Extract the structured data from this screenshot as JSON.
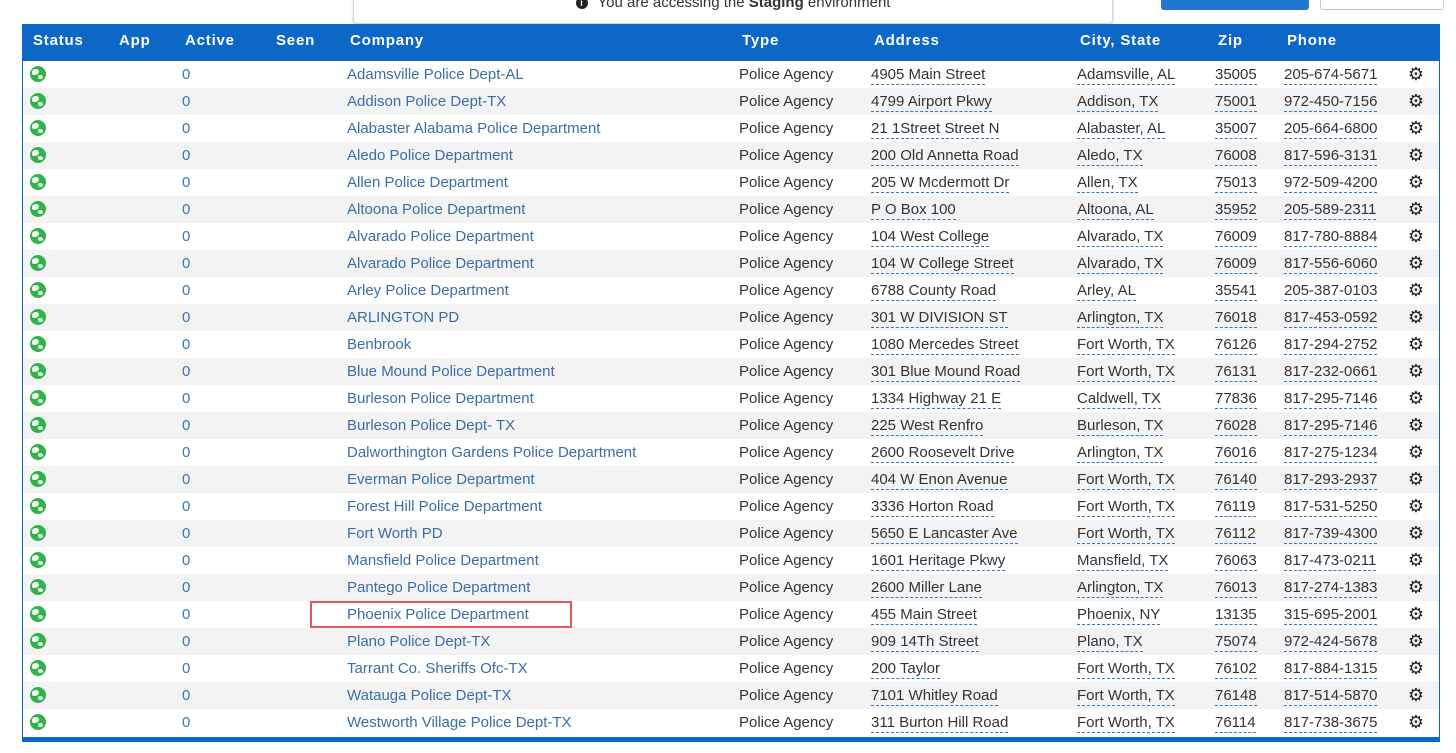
{
  "banner": {
    "prefix": "You are accessing the ",
    "env": "Staging",
    "suffix": " environment"
  },
  "table": {
    "headers": {
      "status": "Status",
      "app": "App",
      "active": "Active",
      "seen": "Seen",
      "company": "Company",
      "type": "Type",
      "address": "Address",
      "city_state": "City, State",
      "zip": "Zip",
      "phone": "Phone"
    },
    "rows": [
      {
        "active": "0",
        "company": "Adamsville Police Dept-AL",
        "type": "Police Agency",
        "address": "4905 Main Street",
        "city": "Adamsville, AL",
        "zip": "35005",
        "phone": "205-674-5671"
      },
      {
        "active": "0",
        "company": "Addison Police Dept-TX",
        "type": "Police Agency",
        "address": "4799 Airport Pkwy",
        "city": "Addison, TX",
        "zip": "75001",
        "phone": "972-450-7156"
      },
      {
        "active": "0",
        "company": "Alabaster Alabama Police Department",
        "type": "Police Agency",
        "address": "21 1Street Street N",
        "city": "Alabaster, AL",
        "zip": "35007",
        "phone": "205-664-6800"
      },
      {
        "active": "0",
        "company": "Aledo Police Department",
        "type": "Police Agency",
        "address": "200 Old Annetta Road",
        "city": "Aledo, TX",
        "zip": "76008",
        "phone": "817-596-3131"
      },
      {
        "active": "0",
        "company": "Allen Police Department",
        "type": "Police Agency",
        "address": "205 W Mcdermott Dr",
        "city": "Allen, TX",
        "zip": "75013",
        "phone": "972-509-4200"
      },
      {
        "active": "0",
        "company": "Altoona Police Department",
        "type": "Police Agency",
        "address": "P O Box 100",
        "city": "Altoona, AL",
        "zip": "35952",
        "phone": "205-589-2311"
      },
      {
        "active": "0",
        "company": "Alvarado Police Department",
        "type": "Police Agency",
        "address": "104 West College",
        "city": "Alvarado, TX",
        "zip": "76009",
        "phone": "817-780-8884"
      },
      {
        "active": "0",
        "company": "Alvarado Police Department",
        "type": "Police Agency",
        "address": "104 W College Street",
        "city": "Alvarado, TX",
        "zip": "76009",
        "phone": "817-556-6060"
      },
      {
        "active": "0",
        "company": "Arley Police Department",
        "type": "Police Agency",
        "address": "6788 County Road",
        "city": "Arley, AL",
        "zip": "35541",
        "phone": "205-387-0103"
      },
      {
        "active": "0",
        "company": "ARLINGTON PD",
        "type": "Police Agency",
        "address": "301 W DIVISION ST",
        "city": "Arlington, TX",
        "zip": "76018",
        "phone": "817-453-0592"
      },
      {
        "active": "0",
        "company": "Benbrook",
        "type": "Police Agency",
        "address": "1080 Mercedes Street",
        "city": "Fort Worth, TX",
        "zip": "76126",
        "phone": "817-294-2752"
      },
      {
        "active": "0",
        "company": "Blue Mound Police Department",
        "type": "Police Agency",
        "address": "301 Blue Mound Road",
        "city": "Fort Worth, TX",
        "zip": "76131",
        "phone": "817-232-0661"
      },
      {
        "active": "0",
        "company": "Burleson Police Department",
        "type": "Police Agency",
        "address": "1334 Highway 21 E",
        "city": "Caldwell, TX",
        "zip": "77836",
        "phone": "817-295-7146"
      },
      {
        "active": "0",
        "company": "Burleson Police Dept- TX",
        "type": "Police Agency",
        "address": "225 West Renfro",
        "city": "Burleson, TX",
        "zip": "76028",
        "phone": "817-295-7146"
      },
      {
        "active": "0",
        "company": "Dalworthington Gardens Police Department",
        "type": "Police Agency",
        "address": "2600 Roosevelt Drive",
        "city": "Arlington, TX",
        "zip": "76016",
        "phone": "817-275-1234"
      },
      {
        "active": "0",
        "company": "Everman Police Department",
        "type": "Police Agency",
        "address": "404 W Enon Avenue",
        "city": "Fort Worth, TX",
        "zip": "76140",
        "phone": "817-293-2937"
      },
      {
        "active": "0",
        "company": "Forest Hill Police Department",
        "type": "Police Agency",
        "address": "3336 Horton Road",
        "city": "Fort Worth, TX",
        "zip": "76119",
        "phone": "817-531-5250"
      },
      {
        "active": "0",
        "company": "Fort Worth PD",
        "type": "Police Agency",
        "address": "5650 E Lancaster Ave",
        "city": "Fort Worth, TX",
        "zip": "76112",
        "phone": "817-739-4300"
      },
      {
        "active": "0",
        "company": "Mansfield Police Department",
        "type": "Police Agency",
        "address": "1601 Heritage Pkwy",
        "city": "Mansfield, TX",
        "zip": "76063",
        "phone": "817-473-0211"
      },
      {
        "active": "0",
        "company": "Pantego Police Department",
        "type": "Police Agency",
        "address": "2600 Miller Lane",
        "city": "Arlington, TX",
        "zip": "76013",
        "phone": "817-274-1383"
      },
      {
        "active": "0",
        "company": "Phoenix Police Department",
        "type": "Police Agency",
        "address": "455 Main Street",
        "city": "Phoenix, NY",
        "zip": "13135",
        "phone": "315-695-2001"
      },
      {
        "active": "0",
        "company": "Plano Police Dept-TX",
        "type": "Police Agency",
        "address": "909 14Th Street",
        "city": "Plano, TX",
        "zip": "75074",
        "phone": "972-424-5678"
      },
      {
        "active": "0",
        "company": "Tarrant Co. Sheriffs Ofc-TX",
        "type": "Police Agency",
        "address": "200 Taylor",
        "city": "Fort Worth, TX",
        "zip": "76102",
        "phone": "817-884-1315"
      },
      {
        "active": "0",
        "company": "Watauga Police Dept-TX",
        "type": "Police Agency",
        "address": "7101 Whitley Road",
        "city": "Fort Worth, TX",
        "zip": "76148",
        "phone": "817-514-5870"
      },
      {
        "active": "0",
        "company": "Westworth Village Police Dept-TX",
        "type": "Police Agency",
        "address": "311 Burton Hill Road",
        "city": "Fort Worth, TX",
        "zip": "76114",
        "phone": "817-738-3675"
      }
    ]
  },
  "colors": {
    "header_bg": "#0c67c7",
    "link": "#3b6ea5",
    "status_online": "#2fb34a",
    "highlight": "#e05a5a"
  },
  "icons": {
    "status": "globe-icon",
    "row_action": "gear-icon",
    "banner": "info-icon"
  }
}
